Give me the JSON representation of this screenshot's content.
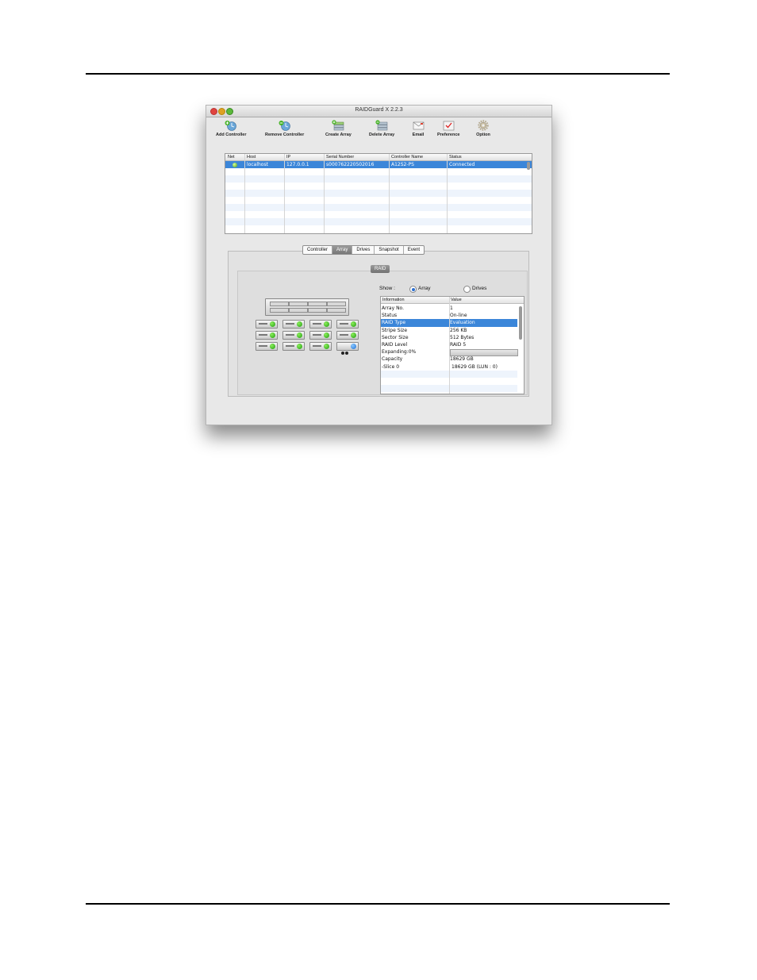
{
  "window": {
    "title": "RAIDGuard X 2.2.3"
  },
  "toolbar": {
    "add_controller": "Add Controller",
    "remove_controller": "Remove Controller",
    "create_array": "Create Array",
    "delete_array": "Delete Array",
    "email": "Email",
    "preference": "Preference",
    "option": "Option"
  },
  "controllers": {
    "columns": [
      "Net",
      "Host",
      "IP",
      "Serial Number",
      "Controller Name",
      "Status"
    ],
    "rows": [
      {
        "host": "localhost",
        "ip": "127.0.0.1",
        "serial": "s000762220502016",
        "name": "A12S2-PS",
        "status": "Connected"
      }
    ]
  },
  "tabs": [
    "Controller",
    "Array",
    "Drives",
    "Snapshot",
    "Event"
  ],
  "active_tab": "Array",
  "raid_label": "RAID",
  "show": {
    "label": "Show :",
    "array": "Array",
    "drives": "Drives",
    "selected": "Array"
  },
  "info_table": {
    "columns": [
      "Information",
      "Value"
    ],
    "rows": [
      {
        "k": "Array No.",
        "v": "1"
      },
      {
        "k": "Status",
        "v": "On-line"
      },
      {
        "k": "RAID Type",
        "v": "Evaluation"
      },
      {
        "k": "Stripe Size",
        "v": "256 KB"
      },
      {
        "k": "Sector Size",
        "v": "512 Bytes"
      },
      {
        "k": "RAID Level",
        "v": "RAID 5"
      },
      {
        "k": "Expanding:0%",
        "v": ""
      },
      {
        "k": "Capacity",
        "v": "18629 GB"
      },
      {
        "k": "-Slice 0",
        "v": "18629 GB (LUN : 0)"
      }
    ]
  },
  "colors": {
    "selection": "#3b86d9",
    "drive_ok": "#1f9b10",
    "drive_spare": "#1d6fd4"
  }
}
